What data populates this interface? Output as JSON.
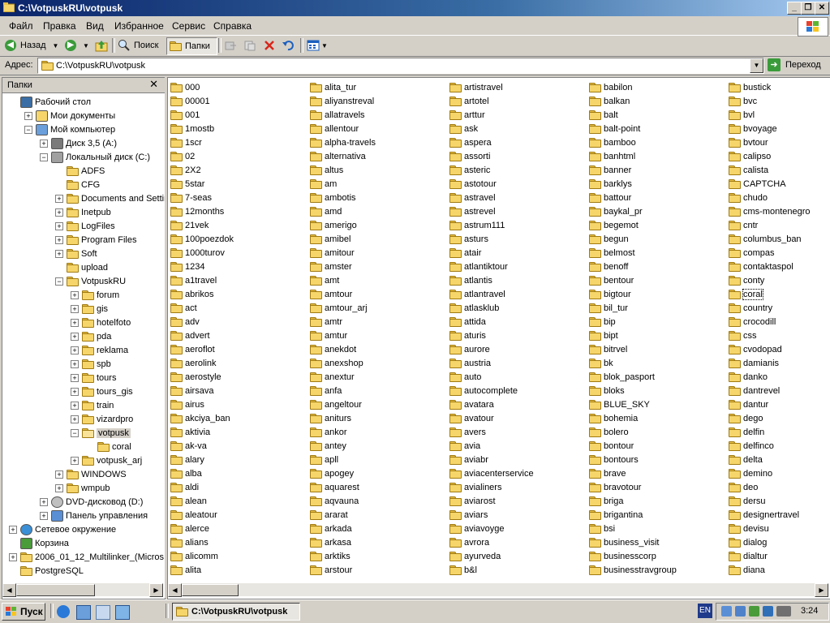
{
  "window": {
    "title": "C:\\VotpuskRU\\votpusk"
  },
  "menu": [
    "Файл",
    "Правка",
    "Вид",
    "Избранное",
    "Сервис",
    "Справка"
  ],
  "toolbar": {
    "back": "Назад",
    "search": "Поиск",
    "folders": "Папки"
  },
  "address": {
    "label": "Адрес:",
    "value": "C:\\VotpuskRU\\votpusk",
    "go": "Переход"
  },
  "folders_pane": {
    "title": "Папки"
  },
  "tree": [
    {
      "label": "Рабочий стол",
      "level": 0,
      "pm": "",
      "icon": "desktop"
    },
    {
      "label": "Мои документы",
      "level": 1,
      "pm": "+",
      "icon": "docs"
    },
    {
      "label": "Мой компьютер",
      "level": 1,
      "pm": "-",
      "icon": "computer"
    },
    {
      "label": "Диск 3,5 (A:)",
      "level": 2,
      "pm": "+",
      "icon": "floppy"
    },
    {
      "label": "Локальный диск (C:)",
      "level": 2,
      "pm": "-",
      "icon": "drive"
    },
    {
      "label": "ADFS",
      "level": 3,
      "pm": "",
      "icon": "folder"
    },
    {
      "label": "CFG",
      "level": 3,
      "pm": "",
      "icon": "folder"
    },
    {
      "label": "Documents and Settings",
      "level": 3,
      "pm": "+",
      "icon": "folder"
    },
    {
      "label": "Inetpub",
      "level": 3,
      "pm": "+",
      "icon": "folder"
    },
    {
      "label": "LogFiles",
      "level": 3,
      "pm": "+",
      "icon": "folder"
    },
    {
      "label": "Program Files",
      "level": 3,
      "pm": "+",
      "icon": "folder"
    },
    {
      "label": "Soft",
      "level": 3,
      "pm": "+",
      "icon": "folder"
    },
    {
      "label": "upload",
      "level": 3,
      "pm": "",
      "icon": "folder"
    },
    {
      "label": "VotpuskRU",
      "level": 3,
      "pm": "-",
      "icon": "folder"
    },
    {
      "label": "forum",
      "level": 4,
      "pm": "+",
      "icon": "folder"
    },
    {
      "label": "gis",
      "level": 4,
      "pm": "+",
      "icon": "folder"
    },
    {
      "label": "hotelfoto",
      "level": 4,
      "pm": "+",
      "icon": "folder"
    },
    {
      "label": "pda",
      "level": 4,
      "pm": "+",
      "icon": "folder"
    },
    {
      "label": "reklama",
      "level": 4,
      "pm": "+",
      "icon": "folder"
    },
    {
      "label": "spb",
      "level": 4,
      "pm": "+",
      "icon": "folder"
    },
    {
      "label": "tours",
      "level": 4,
      "pm": "+",
      "icon": "folder"
    },
    {
      "label": "tours_gis",
      "level": 4,
      "pm": "+",
      "icon": "folder"
    },
    {
      "label": "train",
      "level": 4,
      "pm": "+",
      "icon": "folder"
    },
    {
      "label": "vizardpro",
      "level": 4,
      "pm": "+",
      "icon": "folder"
    },
    {
      "label": "votpusk",
      "level": 4,
      "pm": "-",
      "icon": "folder-open",
      "selected": true
    },
    {
      "label": "coral",
      "level": 5,
      "pm": "",
      "icon": "folder"
    },
    {
      "label": "votpusk_arj",
      "level": 4,
      "pm": "+",
      "icon": "folder"
    },
    {
      "label": "WINDOWS",
      "level": 3,
      "pm": "+",
      "icon": "folder"
    },
    {
      "label": "wmpub",
      "level": 3,
      "pm": "+",
      "icon": "folder"
    },
    {
      "label": "DVD-дисковод (D:)",
      "level": 2,
      "pm": "+",
      "icon": "dvd"
    },
    {
      "label": "Панель управления",
      "level": 2,
      "pm": "+",
      "icon": "control"
    },
    {
      "label": "Сетевое окружение",
      "level": 0,
      "pm": "+",
      "icon": "network"
    },
    {
      "label": "Корзина",
      "level": 0,
      "pm": "",
      "icon": "recycle"
    },
    {
      "label": "2006_01_12_Multilinker_(Micros",
      "level": 0,
      "pm": "+",
      "icon": "folder"
    },
    {
      "label": "PostgreSQL",
      "level": 0,
      "pm": "",
      "icon": "folder"
    }
  ],
  "files": [
    [
      "000",
      "00001",
      "001",
      "1mostb",
      "1scr",
      "02",
      "2X2",
      "5star",
      "7-seas",
      "12months",
      "21vek",
      "100poezdok",
      "1000turov",
      "1234",
      "a1travel",
      "abrikos",
      "act",
      "adv",
      "advert",
      "aeroflot",
      "aerolink",
      "aerostyle",
      "airsava",
      "airus",
      "akciya_ban",
      "aktivia",
      "ak-va",
      "alary",
      "alba",
      "aldi",
      "alean",
      "aleatour",
      "alerce",
      "alians",
      "alicomm",
      "alita"
    ],
    [
      "alita_tur",
      "aliyanstreval",
      "allatravels",
      "allentour",
      "alpha-travels",
      "alternativa",
      "altus",
      "am",
      "ambotis",
      "amd",
      "amerigo",
      "amibel",
      "amitour",
      "amster",
      "amt",
      "amtour",
      "amtour_arj",
      "amtr",
      "amtur",
      "anekdot",
      "anexshop",
      "anextur",
      "anfa",
      "angeltour",
      "aniturs",
      "ankor",
      "antey",
      "apll",
      "apogey",
      "aquarest",
      "aqvauna",
      "ararat",
      "arkada",
      "arkasa",
      "arktiks",
      "arstour"
    ],
    [
      "artistravel",
      "artotel",
      "arttur",
      "ask",
      "aspera",
      "assorti",
      "asteric",
      "astotour",
      "astravel",
      "astrevel",
      "astrum111",
      "asturs",
      "atair",
      "atlantiktour",
      "atlantis",
      "atlantravel",
      "atlasklub",
      "attida",
      "aturis",
      "aurore",
      "austria",
      "auto",
      "autocomplete",
      "avatara",
      "avatour",
      "avers",
      "avia",
      "aviabr",
      "aviacenterservice",
      "avialiners",
      "aviarost",
      "aviars",
      "aviavoyge",
      "avrora",
      "ayurveda",
      "b&l"
    ],
    [
      "babilon",
      "balkan",
      "balt",
      "balt-point",
      "bamboo",
      "banhtml",
      "banner",
      "barklys",
      "battour",
      "baykal_pr",
      "begemot",
      "begun",
      "belmost",
      "benoff",
      "bentour",
      "bigtour",
      "bil_tur",
      "bip",
      "bipt",
      "bitrvel",
      "bk",
      "blok_pasport",
      "bloks",
      "BLUE_SKY",
      "bohemia",
      "bolero",
      "bontour",
      "bontours",
      "brave",
      "bravotour",
      "briga",
      "brigantina",
      "bsi",
      "business_visit",
      "businesscorp",
      "businesstravgroup"
    ],
    [
      "bustick",
      "bvc",
      "bvl",
      "bvoyage",
      "bvtour",
      "calipso",
      "calista",
      "CAPTCHA",
      "chudo",
      "cms-montenegro",
      "cntr",
      "columbus_ban",
      "compas",
      "contaktaspol",
      "conty",
      "coral",
      "country",
      "crocodill",
      "css",
      "cvodopad",
      "damianis",
      "danko",
      "dantrevel",
      "dantur",
      "dego",
      "delfin",
      "delfinco",
      "delta",
      "demino",
      "deo",
      "dersu",
      "designertravel",
      "devisu",
      "dialog",
      "dialtur",
      "diana"
    ]
  ],
  "focused_file": "coral",
  "taskbar": {
    "start": "Пуск",
    "window": "C:\\VotpuskRU\\votpusk",
    "lang": "EN",
    "clock": "3:24"
  }
}
